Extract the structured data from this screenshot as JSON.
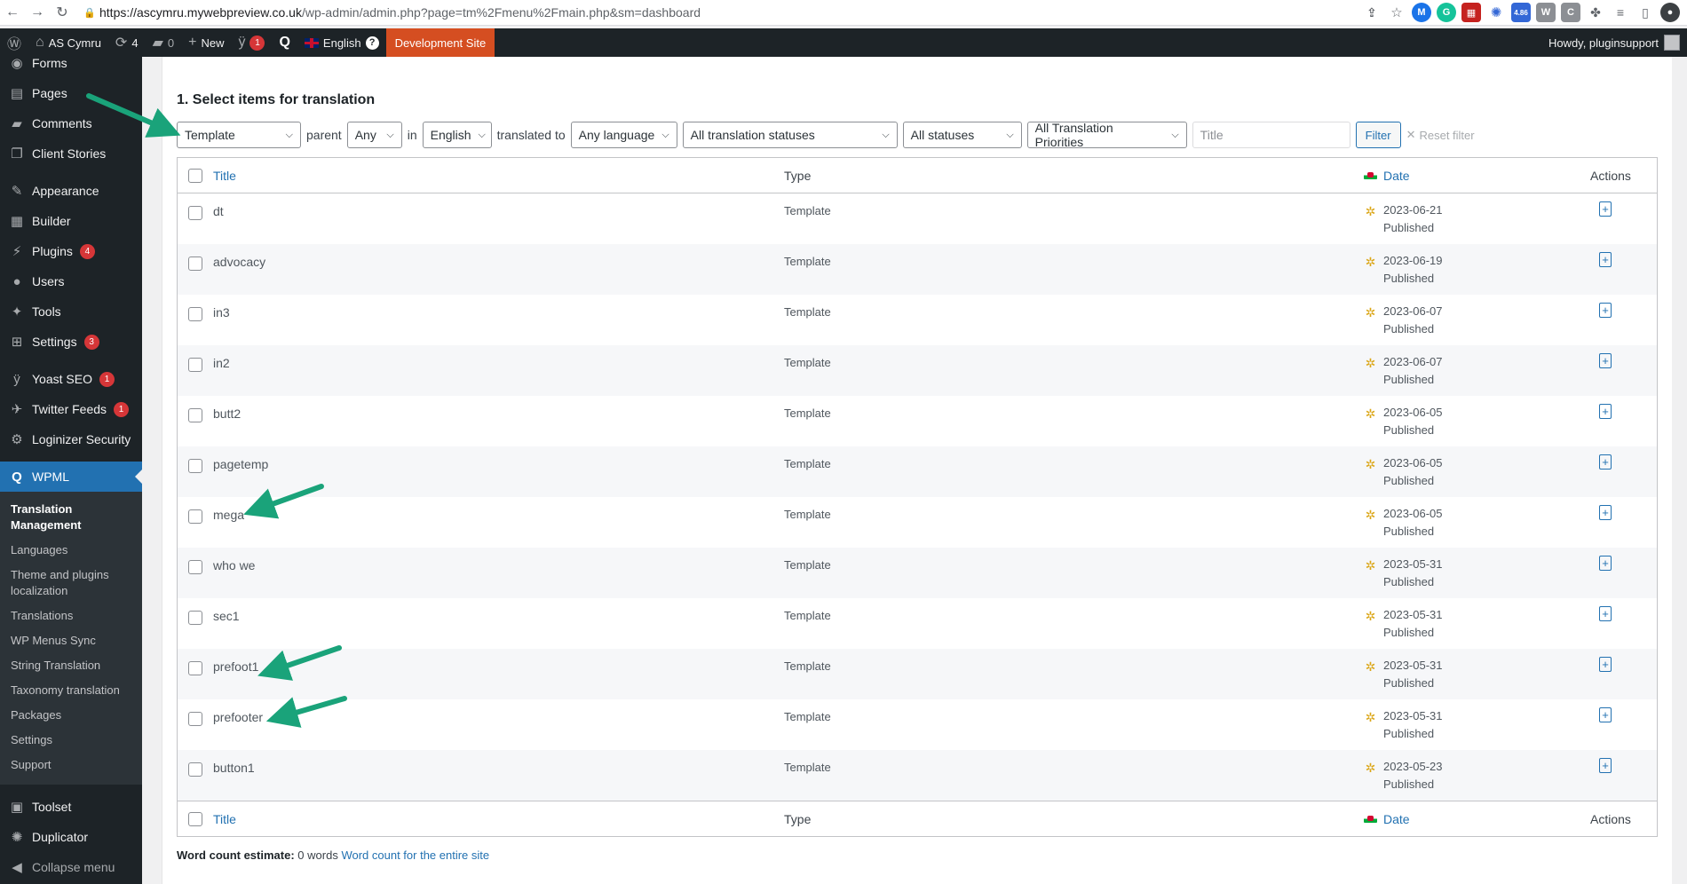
{
  "browser": {
    "url_host": "https://ascymru.mywebpreview.co.uk",
    "url_path": "/wp-admin/admin.php?page=tm%2Fmenu%2Fmain.php&sm=dashboard",
    "ext_badge": "4.86"
  },
  "adminbar": {
    "site_name": "AS Cymru",
    "updates_count": "4",
    "comments_count": "0",
    "new_label": "New",
    "yoast_count": "1",
    "language": "English",
    "dev_site": "Development Site",
    "howdy": "Howdy, pluginsupport"
  },
  "sidebar": {
    "items_top": [
      {
        "label": "Forms",
        "icon": "forms-icon"
      },
      {
        "label": "Pages",
        "icon": "pages-icon"
      },
      {
        "label": "Comments",
        "icon": "comments-icon"
      },
      {
        "label": "Client Stories",
        "icon": "client-stories-icon"
      }
    ],
    "items_mid": [
      {
        "label": "Appearance",
        "icon": "appearance-icon"
      },
      {
        "label": "Builder",
        "icon": "builder-icon"
      },
      {
        "label": "Plugins",
        "icon": "plugins-icon",
        "badge": "4"
      },
      {
        "label": "Users",
        "icon": "users-icon"
      },
      {
        "label": "Tools",
        "icon": "tools-icon"
      },
      {
        "label": "Settings",
        "icon": "settings-icon",
        "badge": "3"
      }
    ],
    "items_plugins": [
      {
        "label": "Yoast SEO",
        "icon": "yoast-icon",
        "badge": "1"
      },
      {
        "label": "Twitter Feeds",
        "icon": "twitter-icon",
        "badge": "1"
      },
      {
        "label": "Loginizer Security",
        "icon": "loginizer-icon"
      }
    ],
    "wpml": "WPML",
    "submenu": [
      "Translation Management",
      "Languages",
      "Theme and plugins localization",
      "Translations",
      "WP Menus Sync",
      "String Translation",
      "Taxonomy translation",
      "Packages",
      "Settings",
      "Support"
    ],
    "items_bottom": [
      {
        "label": "Toolset",
        "icon": "toolset-icon"
      },
      {
        "label": "Duplicator",
        "icon": "duplicator-icon"
      },
      {
        "label": "Collapse menu",
        "icon": "collapse-icon"
      }
    ]
  },
  "main": {
    "section_title": "1. Select items for translation",
    "filters": {
      "type_value": "Template",
      "parent_label": "parent",
      "parent_value": "Any",
      "in_label": "in",
      "source_lang": "English",
      "translated_to_label": "translated to",
      "target_lang": "Any language",
      "translation_status": "All translation statuses",
      "status": "All statuses",
      "priority": "All Translation Priorities",
      "title_placeholder": "Title",
      "filter_button": "Filter",
      "reset_label": "Reset filter"
    },
    "table": {
      "columns": {
        "title": "Title",
        "type": "Type",
        "date": "Date",
        "actions": "Actions"
      },
      "rows": [
        {
          "title": "dt",
          "type": "Template",
          "date": "2023-06-21",
          "status": "Published"
        },
        {
          "title": "advocacy",
          "type": "Template",
          "date": "2023-06-19",
          "status": "Published"
        },
        {
          "title": "in3",
          "type": "Template",
          "date": "2023-06-07",
          "status": "Published"
        },
        {
          "title": "in2",
          "type": "Template",
          "date": "2023-06-07",
          "status": "Published"
        },
        {
          "title": "butt2",
          "type": "Template",
          "date": "2023-06-05",
          "status": "Published"
        },
        {
          "title": "pagetemp",
          "type": "Template",
          "date": "2023-06-05",
          "status": "Published"
        },
        {
          "title": "mega",
          "type": "Template",
          "date": "2023-06-05",
          "status": "Published"
        },
        {
          "title": "who we",
          "type": "Template",
          "date": "2023-05-31",
          "status": "Published"
        },
        {
          "title": "sec1",
          "type": "Template",
          "date": "2023-05-31",
          "status": "Published"
        },
        {
          "title": "prefoot1",
          "type": "Template",
          "date": "2023-05-31",
          "status": "Published"
        },
        {
          "title": "prefooter",
          "type": "Template",
          "date": "2023-05-31",
          "status": "Published"
        },
        {
          "title": "button1",
          "type": "Template",
          "date": "2023-05-23",
          "status": "Published"
        }
      ]
    },
    "word_count": {
      "label": "Word count estimate:",
      "value": "0 words",
      "link": "Word count for the entire site"
    }
  },
  "colors": {
    "admin_dark": "#1d2327",
    "wp_blue": "#2271b1",
    "annotation_arrow": "#1aa37a",
    "dev_site": "#d54e21"
  }
}
